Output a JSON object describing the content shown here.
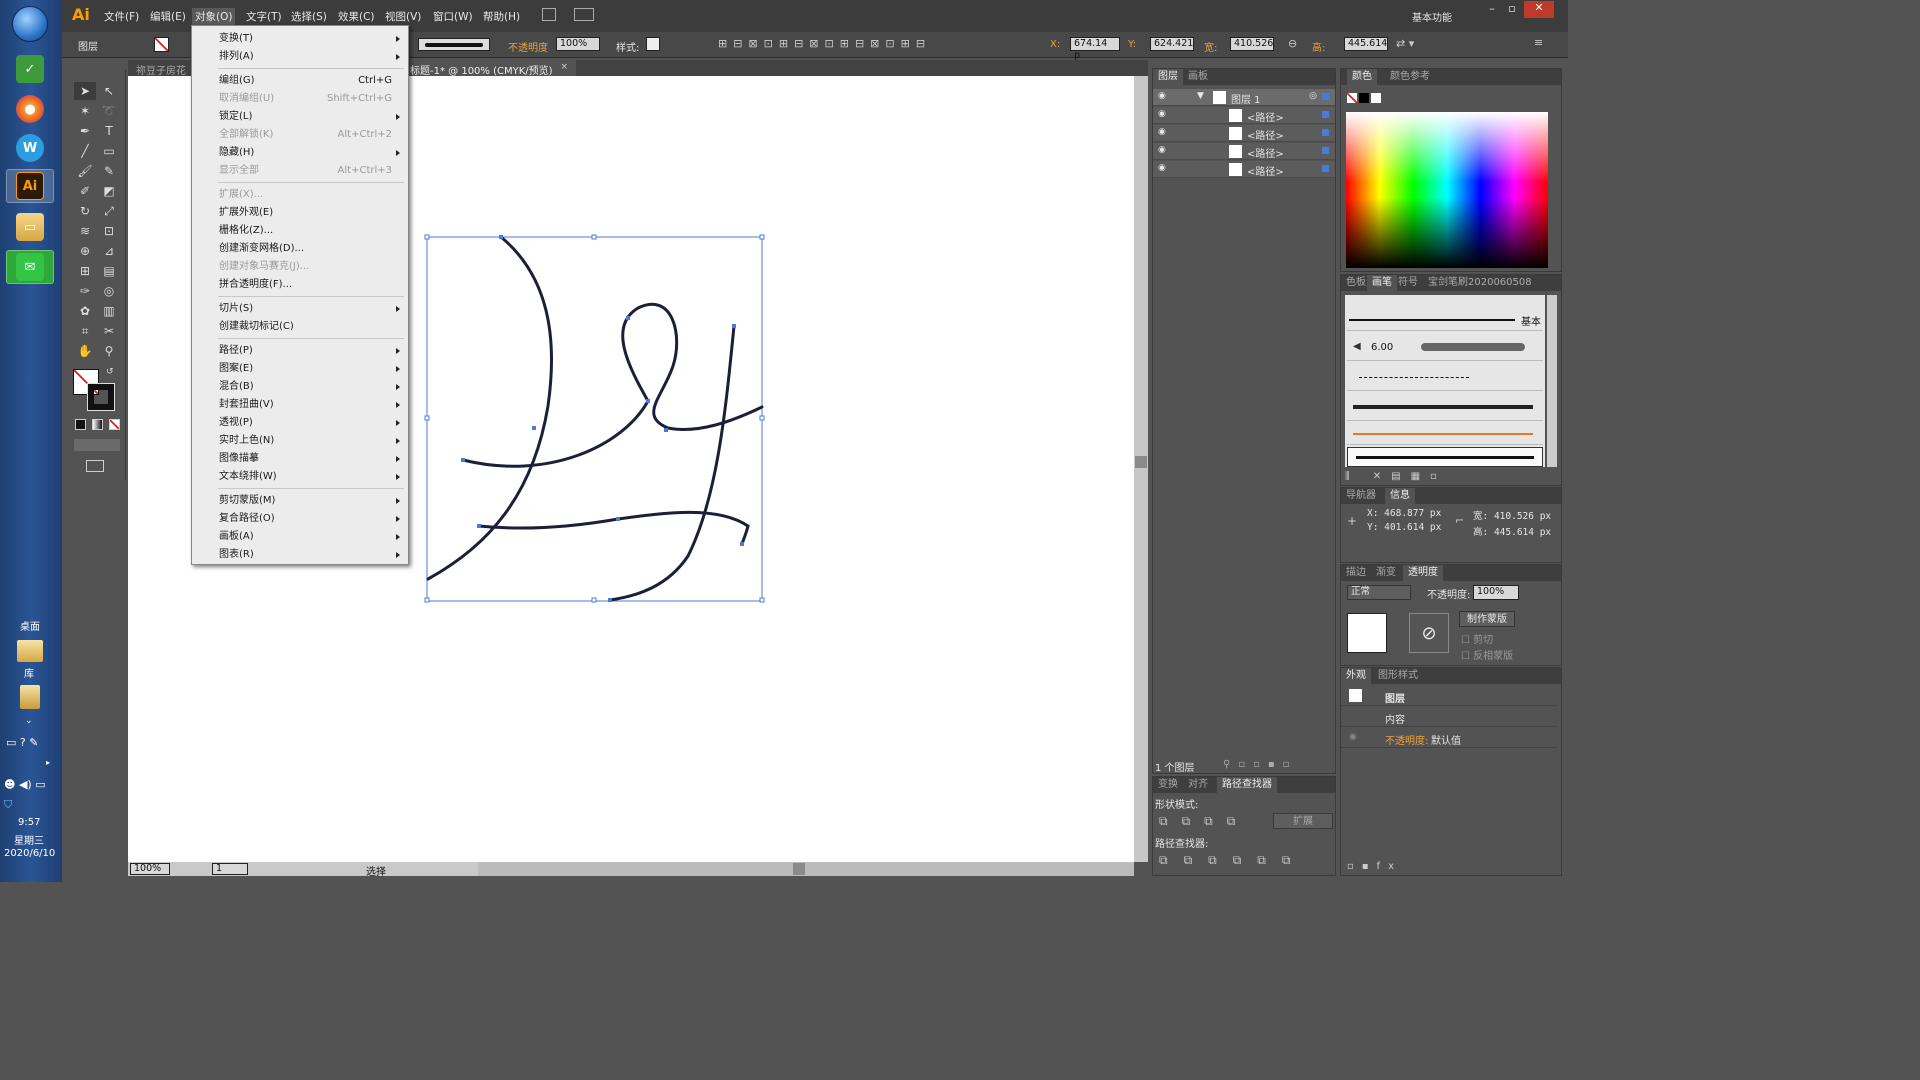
{
  "taskbar": {
    "desktop_label": "桌面",
    "library_label": "库",
    "clock_time": "9:57",
    "clock_day": "星期三",
    "clock_date": "2020/6/10"
  },
  "app": {
    "logo": "Ai",
    "workspace": "基本功能",
    "menus": [
      "文件(F)",
      "编辑(E)",
      "对象(O)",
      "文字(T)",
      "选择(S)",
      "效果(C)",
      "视图(V)",
      "窗口(W)",
      "帮助(H)"
    ]
  },
  "control": {
    "selection_label": "图层",
    "opacity_label": "不透明度",
    "opacity_value": "100%",
    "style_label": "样式:",
    "x_label": "X:",
    "x_value": "674.14 p",
    "y_label": "Y:",
    "y_value": "624.421",
    "w_label": "宽:",
    "w_value": "410.526",
    "h_label": "高:",
    "h_value": "445.614"
  },
  "doc": {
    "tab_prev": "祢豆子房花",
    "tab_title": "标题-1* @ 100% (CMYK/预览)",
    "zoom": "100%",
    "artboard": "1",
    "status": "选择"
  },
  "object_menu": [
    {
      "label": "变换(T)",
      "shortcut": "",
      "sub": true,
      "disabled": false
    },
    {
      "label": "排列(A)",
      "shortcut": "",
      "sub": true,
      "disabled": false
    },
    {
      "label": "编组(G)",
      "shortcut": "Ctrl+G",
      "sub": false,
      "disabled": false
    },
    {
      "label": "取消编组(U)",
      "shortcut": "Shift+Ctrl+G",
      "sub": false,
      "disabled": true
    },
    {
      "label": "锁定(L)",
      "shortcut": "",
      "sub": true,
      "disabled": false
    },
    {
      "label": "全部解锁(K)",
      "shortcut": "Alt+Ctrl+2",
      "sub": false,
      "disabled": true
    },
    {
      "label": "隐藏(H)",
      "shortcut": "",
      "sub": true,
      "disabled": false
    },
    {
      "label": "显示全部",
      "shortcut": "Alt+Ctrl+3",
      "sub": false,
      "disabled": true
    },
    {
      "label": "扩展(X)...",
      "shortcut": "",
      "sub": false,
      "disabled": true
    },
    {
      "label": "扩展外观(E)",
      "shortcut": "",
      "sub": false,
      "disabled": false
    },
    {
      "label": "栅格化(Z)...",
      "shortcut": "",
      "sub": false,
      "disabled": false
    },
    {
      "label": "创建渐变网格(D)...",
      "shortcut": "",
      "sub": false,
      "disabled": false
    },
    {
      "label": "创建对象马赛克(J)...",
      "shortcut": "",
      "sub": false,
      "disabled": true
    },
    {
      "label": "拼合透明度(F)...",
      "shortcut": "",
      "sub": false,
      "disabled": false
    },
    {
      "label": "切片(S)",
      "shortcut": "",
      "sub": true,
      "disabled": false
    },
    {
      "label": "创建裁切标记(C)",
      "shortcut": "",
      "sub": false,
      "disabled": false
    },
    {
      "label": "路径(P)",
      "shortcut": "",
      "sub": true,
      "disabled": false
    },
    {
      "label": "图案(E)",
      "shortcut": "",
      "sub": true,
      "disabled": false
    },
    {
      "label": "混合(B)",
      "shortcut": "",
      "sub": true,
      "disabled": false
    },
    {
      "label": "封套扭曲(V)",
      "shortcut": "",
      "sub": true,
      "disabled": false
    },
    {
      "label": "透视(P)",
      "shortcut": "",
      "sub": true,
      "disabled": false
    },
    {
      "label": "实时上色(N)",
      "shortcut": "",
      "sub": true,
      "disabled": false
    },
    {
      "label": "图像描摹",
      "shortcut": "",
      "sub": true,
      "disabled": false
    },
    {
      "label": "文本绕排(W)",
      "shortcut": "",
      "sub": true,
      "disabled": false
    },
    {
      "label": "剪切蒙版(M)",
      "shortcut": "",
      "sub": true,
      "disabled": false
    },
    {
      "label": "复合路径(O)",
      "shortcut": "",
      "sub": true,
      "disabled": false
    },
    {
      "label": "画板(A)",
      "shortcut": "",
      "sub": true,
      "disabled": false
    },
    {
      "label": "图表(R)",
      "shortcut": "",
      "sub": true,
      "disabled": false
    }
  ],
  "layers_panel": {
    "tabs": [
      "图层",
      "画板"
    ],
    "layer_name": "图层 1",
    "items": [
      "<路径>",
      "<路径>",
      "<路径>",
      "<路径>"
    ],
    "footer": "1 个图层"
  },
  "color_panel": {
    "tabs": [
      "颜色",
      "颜色参考"
    ]
  },
  "brush_panel": {
    "tabs": [
      "色板",
      "画笔",
      "符号",
      "宝剑笔刷2020060508"
    ],
    "basic_label": "基本",
    "size_value": "6.00"
  },
  "info_panel": {
    "tabs": [
      "导航器",
      "信息"
    ],
    "x": "X: 468.877 px",
    "y": "Y: 401.614 px",
    "w": "宽: 410.526 px",
    "h": "高: 445.614 px"
  },
  "transparency_panel": {
    "tabs": [
      "描边",
      "渐变",
      "透明度"
    ],
    "blend_mode": "正常",
    "opacity_label": "不透明度:",
    "opacity_value": "100%",
    "make_mask": "制作蒙版",
    "clip": "剪切",
    "invert": "反相蒙版"
  },
  "appearance_panel": {
    "tabs": [
      "外观",
      "图形样式"
    ],
    "row_layer": "图层",
    "row_content": "内容",
    "row_opacity_label": "不透明度:",
    "row_opacity_value": "默认值"
  },
  "pathfinder_panel": {
    "tabs": [
      "变换",
      "对齐",
      "路径查找器"
    ],
    "shape_modes": "形状模式:",
    "expand": "扩展",
    "pathfinders": "路径查找器:"
  },
  "colors": {
    "selection_blue": "#4a7bd6",
    "ai_orange": "#ff9a00",
    "opacity_orange": "#e8a33d"
  }
}
